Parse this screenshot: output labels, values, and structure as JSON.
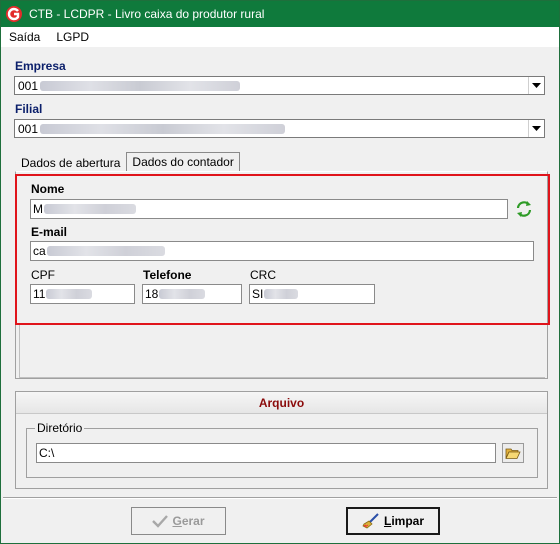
{
  "window": {
    "title": "CTB - LCDPR - Livro caixa do produtor rural"
  },
  "menu": {
    "items": [
      {
        "label": "Saída"
      },
      {
        "label": "LGPD"
      }
    ]
  },
  "empresa": {
    "label": "Empresa",
    "value": "001"
  },
  "filial": {
    "label": "Filial",
    "value": "001"
  },
  "tabs": [
    {
      "label": "Dados de abertura"
    },
    {
      "label": "Dados do contador"
    }
  ],
  "contador": {
    "nome_label": "Nome",
    "nome_value": "M",
    "email_label": "E-mail",
    "email_value": "ca",
    "cpf_label": "CPF",
    "cpf_value": "11",
    "telefone_label": "Telefone",
    "telefone_value": "18",
    "crc_label": "CRC",
    "crc_value": "SI"
  },
  "arquivo": {
    "header": "Arquivo",
    "diretorio_label": "Diretório",
    "diretorio_value": "C:\\"
  },
  "buttons": {
    "gerar_first": "G",
    "gerar_rest": "erar",
    "limpar_first": "L",
    "limpar_rest": "impar"
  },
  "colors": {
    "titlebar": "#0f7a3c",
    "highlight": "#e0141b",
    "section_title": "#8b0b0b",
    "label_blue": "#0b1f6b"
  },
  "icons": [
    "app-logo-icon",
    "refresh-icon",
    "folder-open-icon",
    "checkmark-icon",
    "broom-icon",
    "dropdown-arrow-icon"
  ]
}
